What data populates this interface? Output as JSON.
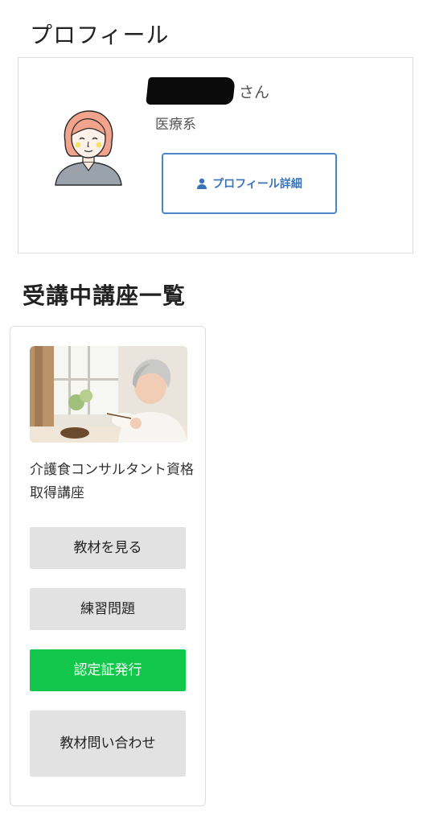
{
  "profile": {
    "section_title": "プロフィール",
    "name_suffix": "さん",
    "profession": "医療系",
    "detail_button_label": "プロフィール詳細",
    "detail_button_icon": "person-icon",
    "avatar_icon": "avatar-woman-illustration"
  },
  "courses": {
    "section_title": "受講中講座一覧",
    "items": [
      {
        "name": "介護食コンサルタント資格取得講座",
        "image": "elderly-woman-eating-photo",
        "buttons": {
          "materials": "教材を見る",
          "practice": "練習問題",
          "certificate": "認定証発行",
          "inquiry": "教材問い合わせ"
        }
      }
    ]
  },
  "colors": {
    "accent_blue": "#4a86c8",
    "certificate_green": "#12c74c",
    "button_gray": "#e2e2e2"
  }
}
